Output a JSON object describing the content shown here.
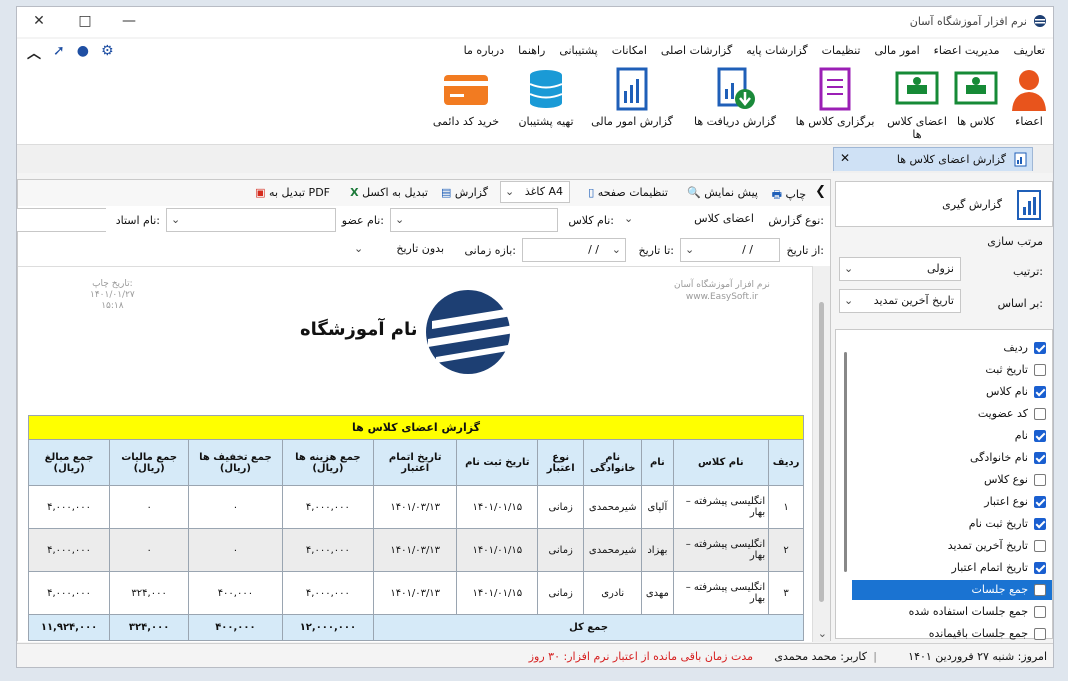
{
  "window": {
    "title": "نرم افزار آموزشگاه آسان"
  },
  "menu": [
    "تعاریف",
    "مدیریت اعضاء",
    "امور مالی",
    "تنظیمات",
    "گزارشات پایه",
    "گزارشات اصلی",
    "امکانات",
    "پشتیبانی",
    "راهنما",
    "درباره ما"
  ],
  "ribbon": [
    "اعضاء",
    "کلاس ها",
    "اعضای کلاس ها",
    "برگزاری کلاس ها",
    "گزارش دریافت ها",
    "گزارش امور مالی",
    "تهیه پشتیبان",
    "خرید کد دائمی"
  ],
  "tab": {
    "label": "گزارش اعضای کلاس ها"
  },
  "toolbar": {
    "print": "چاپ",
    "preview": "پیش نمایش",
    "page_settings": "تنظیمات صفحه",
    "paper": "کاغذ A4",
    "report": "گزارش",
    "excel": "تبدیل به اکسل",
    "pdf": "تبدیل به PDF"
  },
  "filters": {
    "report_type_label": "نوع گزارش:",
    "report_type": "اعضای کلاس",
    "class_label": "نام کلاس:",
    "member_label": "نام عضو:",
    "teacher_label": "نام استاد:",
    "from_label": "از تاریخ:",
    "to_label": "تا تاریخ:",
    "date_sep": "/    /",
    "period_label": "بازه زمانی:",
    "period": "بدون تاریخ"
  },
  "sidepanel": {
    "report_btn": "گزارش گیری",
    "sort_title": "مرتب سازی",
    "order_label": "ترتیب:",
    "order": "نزولی",
    "basis_label": "بر اساس:",
    "basis": "تاریخ آخرین تمدید"
  },
  "columns": [
    {
      "label": "ردیف",
      "checked": true
    },
    {
      "label": "تاریخ ثبت",
      "checked": false
    },
    {
      "label": "نام کلاس",
      "checked": true
    },
    {
      "label": "کد عضویت",
      "checked": false
    },
    {
      "label": "نام",
      "checked": true
    },
    {
      "label": "نام خانوادگی",
      "checked": true
    },
    {
      "label": "نوع کلاس",
      "checked": false
    },
    {
      "label": "نوع اعتبار",
      "checked": true
    },
    {
      "label": "تاریخ ثبت نام",
      "checked": true
    },
    {
      "label": "تاریخ آخرین تمدید",
      "checked": false
    },
    {
      "label": "تاریخ اتمام اعتبار",
      "checked": true
    },
    {
      "label": "جمع جلسات",
      "checked": false
    },
    {
      "label": "جمع جلسات استفاده شده",
      "checked": false
    },
    {
      "label": "جمع جلسات باقیمانده",
      "checked": false
    }
  ],
  "report": {
    "software": "نرم افزار آموزشگاه آسان",
    "site": "www.EasySoft.ir",
    "print_date_label": "تاریخ چاپ:",
    "print_date": "۱۴۰۱/۰۱/۲۷",
    "print_time": "۱۵:۱۸",
    "school_name": "نام آموزشگاه",
    "title": "گزارش اعضای کلاس ها",
    "headers": [
      "ردیف",
      "نام کلاس",
      "نام",
      "نام خانوادگی",
      "نوع اعتبار",
      "تاریخ ثبت نام",
      "تاریخ اتمام اعتبار",
      "جمع هزینه ها (ریال)",
      "جمع تخفیف ها (ریال)",
      "جمع مالیات (ریال)",
      "جمع مبالغ (ریال)"
    ],
    "rows": [
      [
        "۱",
        "انگلیسی پیشرفته – بهار",
        "آلپای",
        "شیرمحمدی",
        "زمانی",
        "۱۴۰۱/۰۱/۱۵",
        "۱۴۰۱/۰۳/۱۳",
        "۴,۰۰۰,۰۰۰",
        "۰",
        "۰",
        "۴,۰۰۰,۰۰۰"
      ],
      [
        "۲",
        "انگلیسی پیشرفته – بهار",
        "بهزاد",
        "شیرمحمدی",
        "زمانی",
        "۱۴۰۱/۰۱/۱۵",
        "۱۴۰۱/۰۳/۱۳",
        "۴,۰۰۰,۰۰۰",
        "۰",
        "۰",
        "۴,۰۰۰,۰۰۰"
      ],
      [
        "۳",
        "انگلیسی پیشرفته – بهار",
        "مهدی",
        "نادری",
        "زمانی",
        "۱۴۰۱/۰۱/۱۵",
        "۱۴۰۱/۰۳/۱۳",
        "۴,۰۰۰,۰۰۰",
        "۴۰۰,۰۰۰",
        "۳۲۴,۰۰۰",
        "۴,۰۰۰,۰۰۰"
      ]
    ],
    "total_label": "جمع کل",
    "totals": [
      "۱۲,۰۰۰,۰۰۰",
      "۴۰۰,۰۰۰",
      "۳۲۴,۰۰۰",
      "۱۱,۹۲۴,۰۰۰"
    ]
  },
  "status": {
    "today": "امروز: شنبه ۲۷ فروردین ۱۴۰۱",
    "user": "کاربر: محمد محمدی",
    "remaining": "مدت زمان باقی مانده از اعتبار نرم افزار: ۳۰ روز"
  }
}
